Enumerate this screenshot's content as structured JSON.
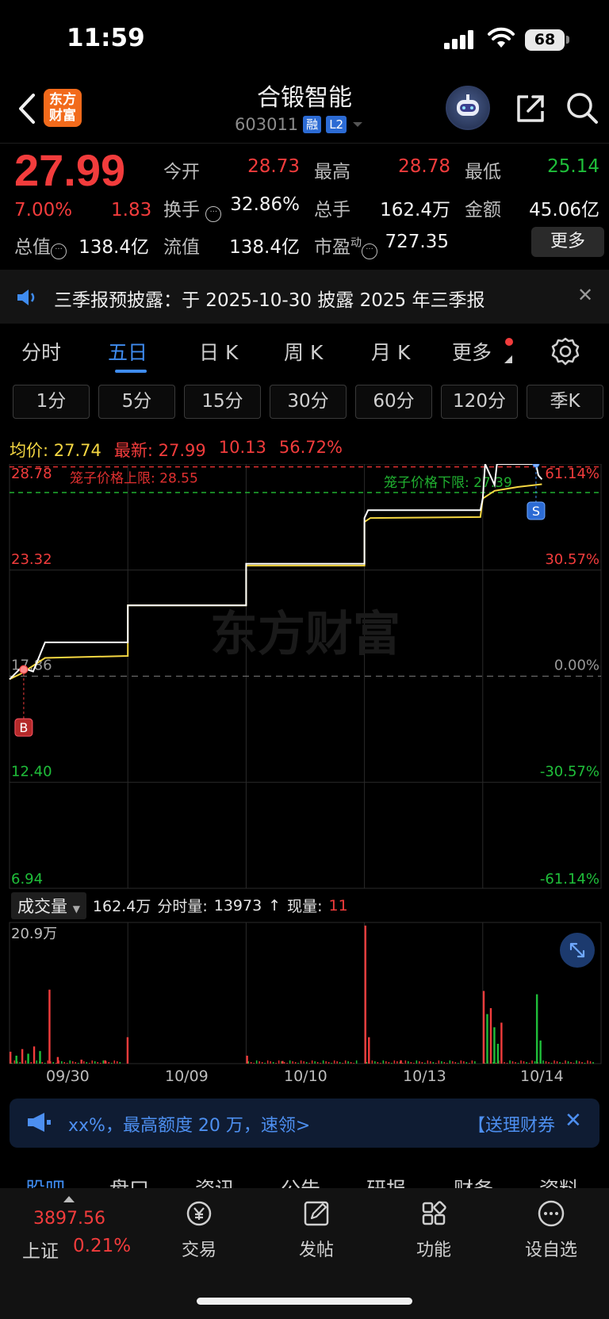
{
  "status_bar": {
    "time": "11:59",
    "battery": "68"
  },
  "header": {
    "logo_line1": "东方",
    "logo_line2": "财富",
    "stock_name": "合锻智能",
    "code": "603011",
    "tag1": "融",
    "tag2": "L2"
  },
  "quote": {
    "price": "27.99",
    "change_pct": "7.00%",
    "change_amt": "1.83",
    "fields": {
      "open_label": "今开",
      "open": "28.73",
      "high_label": "最高",
      "high": "28.78",
      "low_label": "最低",
      "low": "25.14",
      "turnover_label": "换手",
      "turnover": "32.86%",
      "volume_label": "总手",
      "volume": "162.4万",
      "amount_label": "金额",
      "amount": "45.06亿",
      "mktcap_label": "总值",
      "mktcap": "138.4亿",
      "float_label": "流值",
      "float": "138.4亿",
      "pe_label": "市盈",
      "pe_sup": "动",
      "pe": "727.35"
    },
    "more_button": "更多"
  },
  "notice": {
    "text": "三季报预披露：于 2025-10-30 披露 2025 年三季报"
  },
  "tabs": {
    "items": [
      "分时",
      "五日",
      "日 K",
      "周 K",
      "月 K",
      "更多"
    ],
    "active": "五日"
  },
  "periods": [
    "1分",
    "5分",
    "15分",
    "30分",
    "60分",
    "120分",
    "季K"
  ],
  "info_row": {
    "avg_label": "均价:",
    "avg_value": "27.74",
    "latest_label": "最新:",
    "latest_value": "27.99",
    "change": "10.13",
    "change_pct": "56.72%"
  },
  "chart_data": {
    "type": "line",
    "title": "",
    "price_axis_left": [
      "28.78",
      "23.32",
      "17.86",
      "12.40",
      "6.94"
    ],
    "pct_axis_right": [
      "61.14%",
      "30.57%",
      "0.00%",
      "-30.57%",
      "-61.14%"
    ],
    "ylim": [
      6.94,
      28.78
    ],
    "base_price": 17.86,
    "cage_upper_label": "笼子价格上限: 28.55",
    "cage_upper": 28.55,
    "cage_lower_label": "笼子价格下限: 27.39",
    "cage_lower": 27.39,
    "watermark": "东方财富",
    "buy_marker": "B",
    "sell_marker": "S",
    "days": [
      "09/30",
      "10/09",
      "10/10",
      "10/13",
      "10/14"
    ],
    "series": [
      {
        "name": "最新",
        "color": "#ffffff",
        "points": [
          [
            0,
            17.7
          ],
          [
            0.1,
            18.3
          ],
          [
            0.2,
            18.1
          ],
          [
            0.3,
            19.6
          ],
          [
            1.0,
            19.6
          ],
          [
            1.0,
            21.5
          ],
          [
            2.0,
            21.5
          ],
          [
            2.0,
            23.65
          ],
          [
            3.0,
            23.65
          ],
          [
            3.0,
            26.0
          ],
          [
            3.03,
            26.4
          ],
          [
            3.98,
            26.4
          ],
          [
            4.0,
            27.0
          ],
          [
            4.02,
            28.78
          ],
          [
            4.1,
            27.7
          ],
          [
            4.12,
            28.78
          ],
          [
            4.45,
            28.78
          ],
          [
            4.47,
            28.2
          ],
          [
            4.5,
            27.99
          ]
        ]
      },
      {
        "name": "均价",
        "color": "#f5d742",
        "points": [
          [
            0,
            17.7
          ],
          [
            0.1,
            18.0
          ],
          [
            0.3,
            18.8
          ],
          [
            1.0,
            18.9
          ],
          [
            1.0,
            21.5
          ],
          [
            2.0,
            21.5
          ],
          [
            2.0,
            23.55
          ],
          [
            3.0,
            23.55
          ],
          [
            3.0,
            25.8
          ],
          [
            3.05,
            26.0
          ],
          [
            3.98,
            26.05
          ],
          [
            4.0,
            27.0
          ],
          [
            4.1,
            27.4
          ],
          [
            4.3,
            27.6
          ],
          [
            4.5,
            27.74
          ]
        ]
      }
    ]
  },
  "volume_section": {
    "selector": "成交量",
    "total": "162.4万",
    "minute_label": "分时量:",
    "minute_value": "13973",
    "arrow": "↑",
    "now_label": "现量:",
    "now_value": "11",
    "max_label": "20.9万",
    "ylim": [
      0,
      20.9
    ],
    "bars": [
      {
        "day": 0.0,
        "h": 1.8,
        "c": "red"
      },
      {
        "day": 0.05,
        "h": 1.2,
        "c": "green"
      },
      {
        "day": 0.1,
        "h": 2.2,
        "c": "red"
      },
      {
        "day": 0.15,
        "h": 1.5,
        "c": "green"
      },
      {
        "day": 0.2,
        "h": 2.6,
        "c": "red"
      },
      {
        "day": 0.25,
        "h": 1.9,
        "c": "green"
      },
      {
        "day": 0.33,
        "h": 11.2,
        "c": "red"
      },
      {
        "day": 0.4,
        "h": 1.0,
        "c": "red"
      },
      {
        "day": 0.6,
        "h": 0.6,
        "c": "red"
      },
      {
        "day": 0.8,
        "h": 0.5,
        "c": "red"
      },
      {
        "day": 0.99,
        "h": 4.0,
        "c": "red"
      },
      {
        "day": 2.0,
        "h": 1.2,
        "c": "red"
      },
      {
        "day": 2.3,
        "h": 0.4,
        "c": "red"
      },
      {
        "day": 3.0,
        "h": 20.9,
        "c": "red"
      },
      {
        "day": 3.03,
        "h": 4.0,
        "c": "red"
      },
      {
        "day": 3.3,
        "h": 0.5,
        "c": "red"
      },
      {
        "day": 4.0,
        "h": 11.0,
        "c": "red"
      },
      {
        "day": 4.03,
        "h": 7.5,
        "c": "green"
      },
      {
        "day": 4.06,
        "h": 8.4,
        "c": "red"
      },
      {
        "day": 4.09,
        "h": 5.5,
        "c": "green"
      },
      {
        "day": 4.12,
        "h": 3.0,
        "c": "green"
      },
      {
        "day": 4.15,
        "h": 6.2,
        "c": "red"
      },
      {
        "day": 4.45,
        "h": 10.5,
        "c": "green"
      },
      {
        "day": 4.48,
        "h": 3.5,
        "c": "green"
      }
    ]
  },
  "ad": {
    "text": "xx%，最高额度 20 万，速领>",
    "text2": "【送理财券"
  },
  "subtabs": [
    "股吧",
    "盘口",
    "资讯",
    "公告",
    "研报",
    "财务",
    "资料"
  ],
  "bottom_nav": {
    "index_value": "3897.56",
    "index_name": "上证",
    "index_pct": "0.21%",
    "items": [
      "交易",
      "发帖",
      "功能",
      "设自选"
    ]
  }
}
